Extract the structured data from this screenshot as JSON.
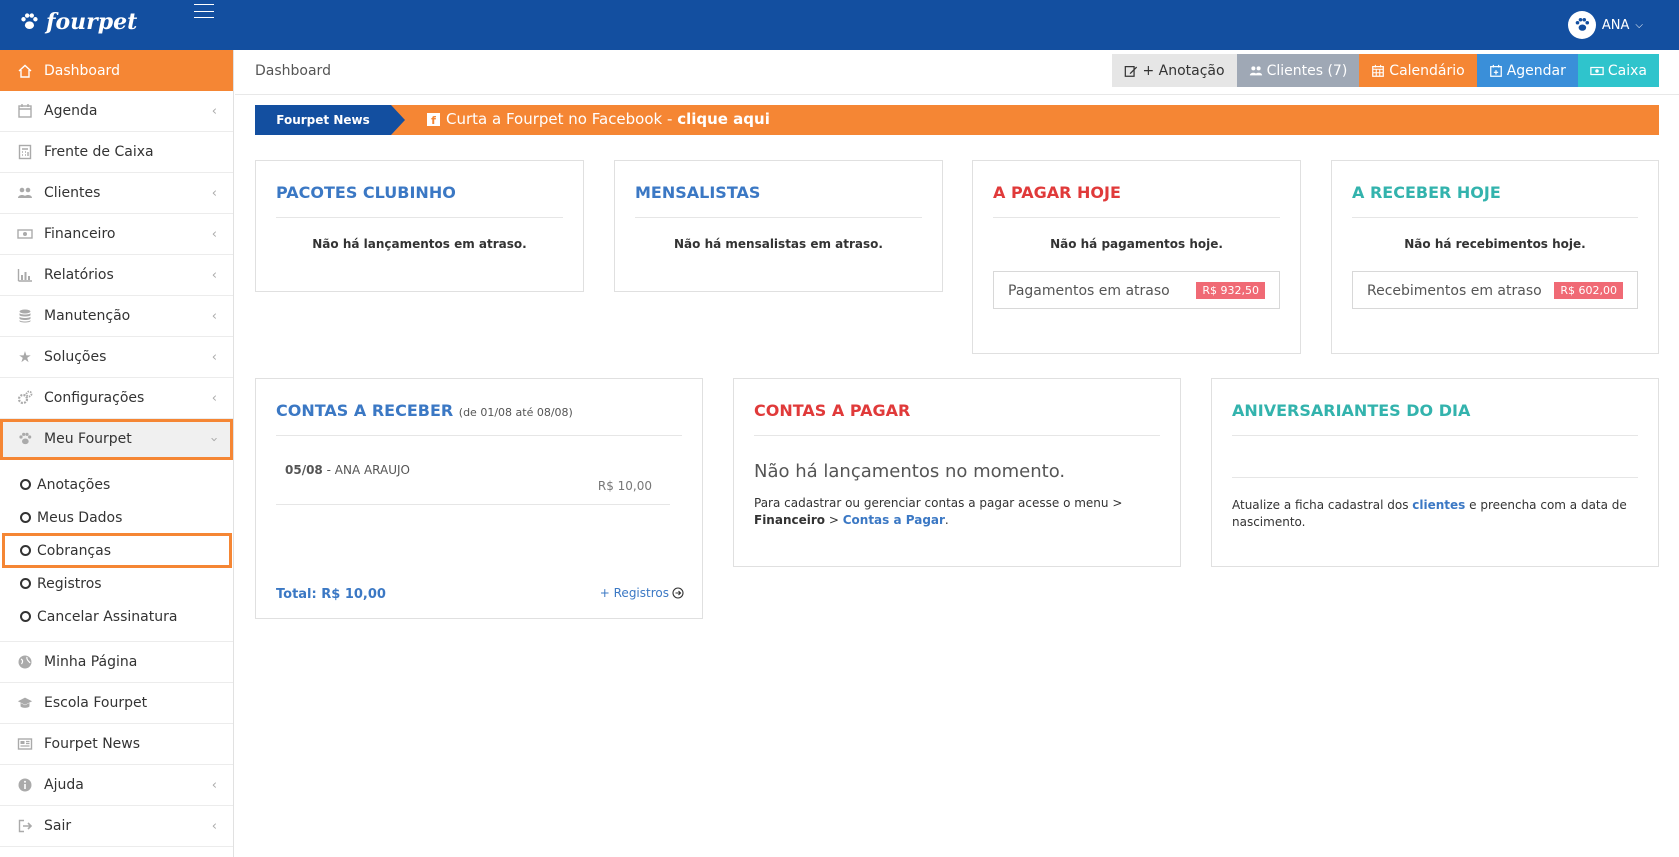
{
  "brand": {
    "name": "fourpet"
  },
  "user": {
    "name": "ANA"
  },
  "sidebar": {
    "items": [
      {
        "label": "Dashboard",
        "icon": "home-icon"
      },
      {
        "label": "Agenda",
        "icon": "calendar-icon"
      },
      {
        "label": "Frente de Caixa",
        "icon": "calculator-icon"
      },
      {
        "label": "Clientes",
        "icon": "users-icon"
      },
      {
        "label": "Financeiro",
        "icon": "money-icon"
      },
      {
        "label": "Relatórios",
        "icon": "bar-chart-icon"
      },
      {
        "label": "Manutenção",
        "icon": "database-icon"
      },
      {
        "label": "Soluções",
        "icon": "star-icon"
      },
      {
        "label": "Configurações",
        "icon": "gears-icon"
      },
      {
        "label": "Meu Fourpet",
        "icon": "paw-icon"
      }
    ],
    "submenu": [
      "Anotações",
      "Meus Dados",
      "Cobranças",
      "Registros",
      "Cancelar Assinatura"
    ],
    "bottom_items": [
      {
        "label": "Minha Página",
        "icon": "globe-icon"
      },
      {
        "label": "Escola Fourpet",
        "icon": "graduation-cap-icon"
      },
      {
        "label": "Fourpet News",
        "icon": "newspaper-icon"
      },
      {
        "label": "Ajuda",
        "icon": "info-icon"
      },
      {
        "label": "Sair",
        "icon": "sign-out-icon"
      }
    ]
  },
  "breadcrumb": "Dashboard",
  "actions": {
    "anotacao": "+ Anotação",
    "clientes": "Clientes (7)",
    "calendario": "Calendário",
    "agendar": "Agendar",
    "caixa": "Caixa"
  },
  "news": {
    "tag": "Fourpet News",
    "text": "Curta a Fourpet no Facebook - ",
    "link": "clique aqui"
  },
  "cards": {
    "pacotes": {
      "title": "PACOTES CLUBINHO",
      "message": "Não há lançamentos em atraso."
    },
    "mensalistas": {
      "title": "MENSALISTAS",
      "message": "Não há mensalistas em atraso."
    },
    "pagar_hoje": {
      "title": "A PAGAR HOJE",
      "message": "Não há pagamentos hoje.",
      "late_label": "Pagamentos em atraso",
      "late_value": "R$ 932,50"
    },
    "receber_hoje": {
      "title": "A RECEBER HOJE",
      "message": "Não há recebimentos hoje.",
      "late_label": "Recebimentos em atraso",
      "late_value": "R$ 602,00"
    },
    "contas_receber": {
      "title": "CONTAS A RECEBER",
      "subtitle": "(de 01/08 até 08/08)",
      "rows": [
        {
          "date": "05/08",
          "name": "- ANA ARAUJO",
          "amount": "R$ 10,00"
        }
      ],
      "total": "Total: R$ 10,00",
      "more": "+ Registros"
    },
    "contas_pagar": {
      "title": "CONTAS A PAGAR",
      "none": "Não há lançamentos no momento.",
      "desc_1": "Para cadastrar ou gerenciar contas a pagar acesse o menu > ",
      "desc_bold": "Financeiro",
      "desc_2": " > ",
      "desc_link": "Contas a Pagar",
      "desc_3": "."
    },
    "aniversariantes": {
      "title": "ANIVERSARIANTES DO DIA",
      "desc_1": "Atualize a ficha cadastral dos ",
      "desc_link": "clientes",
      "desc_2": " e preencha com a data de nascimento."
    }
  },
  "colors": {
    "brand_blue": "#134fa0",
    "accent_orange": "#f58634",
    "danger": "#e03a3a",
    "teal": "#33b3ad"
  }
}
